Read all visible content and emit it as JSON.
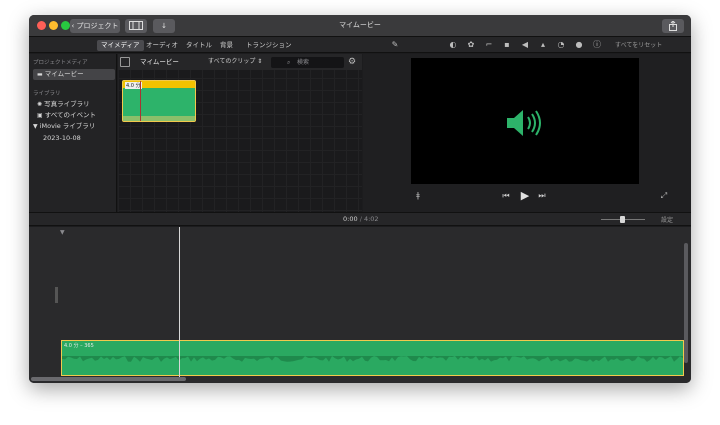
{
  "window": {
    "title": "マイムービー"
  },
  "titlebar": {
    "back_label": "プロジェクト"
  },
  "toolbar": {
    "tabs": [
      "マイメディア",
      "オーディオ",
      "タイトル",
      "背景",
      "トランジション"
    ],
    "reset_label": "すべてをリセット"
  },
  "sidebar": {
    "project_media_header": "プロジェクトメディア",
    "project_item": "マイムービー",
    "library_header": "ライブラリ",
    "library_items": [
      "写真ライブラリ",
      "すべてのイベント"
    ],
    "imovie_library": "iMovie ライブラリ",
    "event_date": "2023-10-08"
  },
  "browser": {
    "title": "マイムービー",
    "filter": "すべてのクリップ",
    "search_placeholder": "検索",
    "clip_duration": "4.0 分"
  },
  "timeline": {
    "current_time": "0:00",
    "separator": "/",
    "total_time": "4:02",
    "settings_label": "設定",
    "clip_label": "4.0 分 – 365"
  },
  "colors": {
    "clip_green": "#2aa961",
    "clip_border": "#f2c94c",
    "speaker": "#2db36a"
  }
}
